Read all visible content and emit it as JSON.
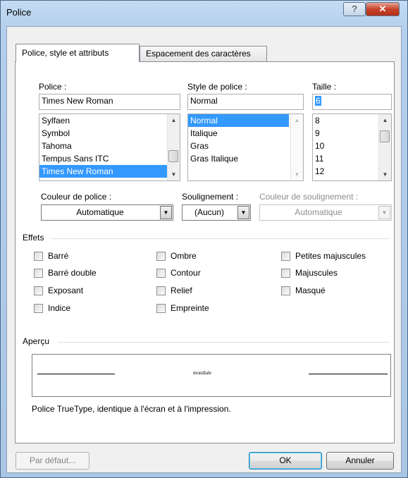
{
  "window": {
    "title": "Police",
    "help_glyph": "?",
    "close_glyph": "✕"
  },
  "tabs": [
    {
      "label": "Police, style et attributs",
      "active": true
    },
    {
      "label": "Espacement des caractères",
      "active": false
    }
  ],
  "font": {
    "label": "Police :",
    "value": "Times New Roman",
    "items": [
      "Sylfaen",
      "Symbol",
      "Tahoma",
      "Tempus Sans ITC",
      "Times New Roman"
    ],
    "selected_index": 4
  },
  "style": {
    "label": "Style de police :",
    "value": "Normal",
    "items": [
      "Normal",
      "Italique",
      "Gras",
      "Gras Italique"
    ],
    "selected_index": 0
  },
  "size": {
    "label": "Taille :",
    "value": "6",
    "items": [
      "8",
      "9",
      "10",
      "11",
      "12"
    ]
  },
  "color": {
    "label": "Couleur de police :",
    "value": "Automatique"
  },
  "underline": {
    "label": "Soulignement :",
    "value": "(Aucun)"
  },
  "underline_color": {
    "label": "Couleur de soulignement :",
    "value": "Automatique"
  },
  "effects": {
    "label": "Effets",
    "col1": [
      "Barré",
      "Barré double",
      "Exposant",
      "Indice"
    ],
    "col2": [
      "Ombre",
      "Contour",
      "Relief",
      "Empreinte"
    ],
    "col3": [
      "Petites majuscules",
      "Majuscules",
      "Masqué"
    ]
  },
  "preview": {
    "label": "Aperçu",
    "sample_text": "mondiale",
    "description": "Police TrueType, identique à l'écran et à l'impression."
  },
  "buttons": {
    "default_label": "Par défaut...",
    "ok_label": "OK",
    "cancel_label": "Annuler"
  },
  "colors": {
    "selection": "#3399ff",
    "window_frame": "#a9c6e6"
  }
}
